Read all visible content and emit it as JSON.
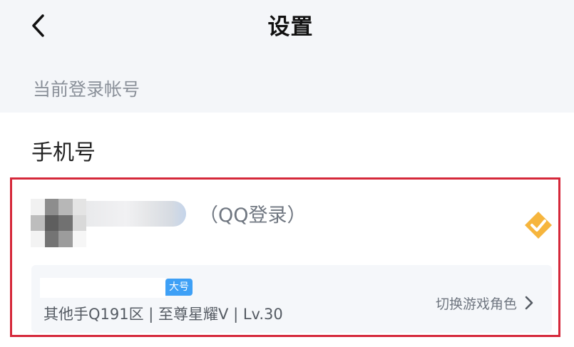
{
  "header": {
    "title": "设置",
    "back_icon": "back-chevron-icon"
  },
  "section": {
    "label": "当前登录帐号"
  },
  "phone": {
    "label": "手机号"
  },
  "account": {
    "login_type": "（QQ登录）",
    "verified_icon": "verified-check-icon",
    "accent_color": "#f6b53d",
    "border_color": "#d5283a",
    "role": {
      "badge": "大号",
      "info": "其他手Q191区 | 至尊星耀V | Lv.30",
      "switch_label": "切换游戏角色",
      "switch_icon": "chevron-right-icon"
    }
  }
}
